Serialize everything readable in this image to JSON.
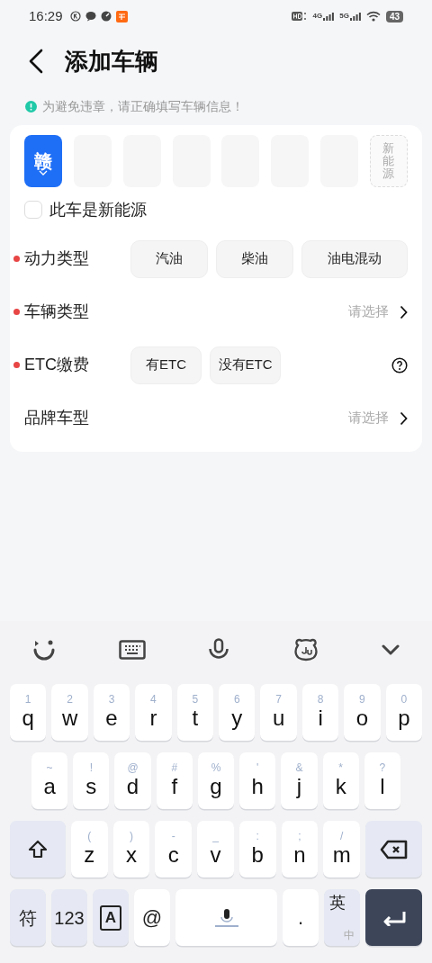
{
  "status_bar": {
    "time": "16:29",
    "networks": [
      "4G",
      "5G"
    ],
    "battery": "43"
  },
  "header": {
    "title": "添加车辆"
  },
  "notice": "为避免违章，请正确填写车辆信息！",
  "plate": {
    "slots": [
      {
        "kind": "province",
        "text": "赣",
        "selected": true
      },
      {
        "kind": "char",
        "selected": false
      },
      {
        "kind": "char",
        "selected": false
      },
      {
        "kind": "char",
        "selected": false
      },
      {
        "kind": "char",
        "selected": false
      },
      {
        "kind": "char",
        "selected": false
      },
      {
        "kind": "char",
        "selected": false
      },
      {
        "kind": "new_energy",
        "text": "新能源",
        "selected": false
      }
    ]
  },
  "new_energy_checkbox": {
    "label": "此车是新能源",
    "checked": false
  },
  "rows": [
    {
      "kind": "options",
      "label": "动力类型",
      "required": true,
      "options": [
        {
          "label": "汽油",
          "selected": false
        },
        {
          "label": "柴油",
          "selected": false
        },
        {
          "label": "油电混动",
          "selected": false
        }
      ]
    },
    {
      "kind": "select",
      "label": "车辆类型",
      "required": true,
      "hint": "请选择"
    },
    {
      "kind": "options",
      "label": "ETC缴费",
      "required": true,
      "help": true,
      "options": [
        {
          "label": "有ETC",
          "selected": false
        },
        {
          "label": "没有ETC",
          "selected": false
        }
      ]
    },
    {
      "kind": "select",
      "label": "品牌车型",
      "required": false,
      "hint": "请选择"
    }
  ],
  "keyboard": {
    "rows": [
      {
        "keys": [
          {
            "kind": "char",
            "label": "q",
            "sub": "1"
          },
          {
            "kind": "char",
            "label": "w",
            "sub": "2"
          },
          {
            "kind": "char",
            "label": "e",
            "sub": "3"
          },
          {
            "kind": "char",
            "label": "r",
            "sub": "4"
          },
          {
            "kind": "char",
            "label": "t",
            "sub": "5"
          },
          {
            "kind": "char",
            "label": "y",
            "sub": "6"
          },
          {
            "kind": "char",
            "label": "u",
            "sub": "7"
          },
          {
            "kind": "char",
            "label": "i",
            "sub": "8"
          },
          {
            "kind": "char",
            "label": "o",
            "sub": "9"
          },
          {
            "kind": "char",
            "label": "p",
            "sub": "0"
          }
        ]
      },
      {
        "keys": [
          {
            "kind": "char",
            "label": "a",
            "sub": "~"
          },
          {
            "kind": "char",
            "label": "s",
            "sub": "!"
          },
          {
            "kind": "char",
            "label": "d",
            "sub": "@"
          },
          {
            "kind": "char",
            "label": "f",
            "sub": "#"
          },
          {
            "kind": "char",
            "label": "g",
            "sub": "%"
          },
          {
            "kind": "char",
            "label": "h",
            "sub": "'"
          },
          {
            "kind": "char",
            "label": "j",
            "sub": "&"
          },
          {
            "kind": "char",
            "label": "k",
            "sub": "*"
          },
          {
            "kind": "char",
            "label": "l",
            "sub": "?"
          }
        ]
      },
      {
        "keys": [
          {
            "kind": "shift"
          },
          {
            "kind": "char",
            "label": "z",
            "sub": "("
          },
          {
            "kind": "char",
            "label": "x",
            "sub": ")"
          },
          {
            "kind": "char",
            "label": "c",
            "sub": "-"
          },
          {
            "kind": "char",
            "label": "v",
            "sub": "_"
          },
          {
            "kind": "char",
            "label": "b",
            "sub": ":"
          },
          {
            "kind": "char",
            "label": "n",
            "sub": ";"
          },
          {
            "kind": "char",
            "label": "m",
            "sub": "/"
          },
          {
            "kind": "backspace"
          }
        ]
      },
      {
        "keys": [
          {
            "kind": "func",
            "label": "符"
          },
          {
            "kind": "func",
            "label": "123"
          },
          {
            "kind": "caps",
            "label": "A"
          },
          {
            "kind": "plain",
            "label": "@"
          },
          {
            "kind": "space"
          },
          {
            "kind": "plain",
            "label": "."
          },
          {
            "kind": "lang",
            "label": "英",
            "sub": "中"
          },
          {
            "kind": "enter"
          }
        ]
      }
    ]
  }
}
